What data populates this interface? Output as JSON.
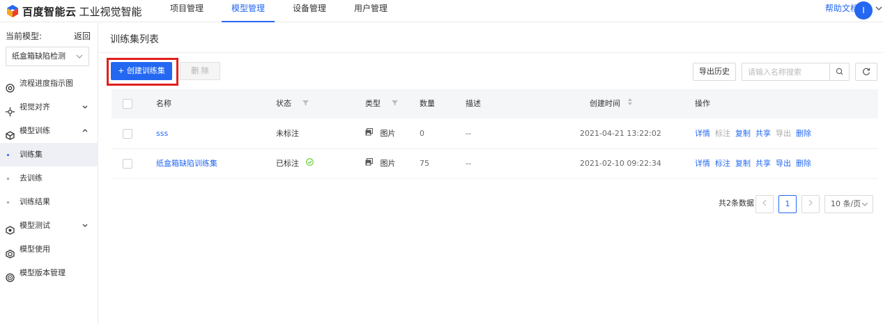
{
  "topbar": {
    "brand": "百度智能云",
    "product": "工业视觉智能",
    "nav": [
      {
        "label": "项目管理",
        "active": false
      },
      {
        "label": "模型管理",
        "active": true
      },
      {
        "label": "设备管理",
        "active": false
      },
      {
        "label": "用户管理",
        "active": false
      }
    ],
    "help": "帮助文档",
    "avatar": "I"
  },
  "sidebar": {
    "current_label": "当前模型:",
    "back": "返回",
    "model": "纸盒箱缺陷检测",
    "items": [
      {
        "label": "流程进度指示图",
        "icon": "flow-icon",
        "chevron": ""
      },
      {
        "label": "视觉对齐",
        "icon": "align-icon",
        "chevron": "down"
      },
      {
        "label": "模型训练",
        "icon": "cube-icon",
        "chevron": "up"
      },
      {
        "label": "训练集",
        "sub": true,
        "active": true
      },
      {
        "label": "去训练",
        "sub": true
      },
      {
        "label": "训练结果",
        "sub": true
      },
      {
        "label": "模型测试",
        "icon": "test-icon",
        "chevron": "down"
      },
      {
        "label": "模型使用",
        "icon": "use-icon",
        "chevron": ""
      },
      {
        "label": "模型版本管理",
        "icon": "version-icon",
        "chevron": ""
      }
    ]
  },
  "main": {
    "title": "训练集列表",
    "create_button": "+ 创建训练集",
    "delete_button": "删 除",
    "export_history": "导出历史",
    "search_placeholder": "请输入名称搜索",
    "columns": {
      "name": "名称",
      "status": "状态",
      "type": "类型",
      "count": "数量",
      "desc": "描述",
      "created": "创建时间",
      "ops": "操作"
    },
    "rows": [
      {
        "name": "sss",
        "status": "未标注",
        "status_done": false,
        "type": "图片",
        "count": "0",
        "desc": "--",
        "created": "2021-04-21 13:22:02"
      },
      {
        "name": "纸盒箱缺陷训练集",
        "status": "已标注",
        "status_done": true,
        "type": "图片",
        "count": "75",
        "desc": "--",
        "created": "2021-02-10 09:22:34"
      }
    ],
    "row_ops": [
      [
        {
          "label": "详情",
          "enabled": true
        },
        {
          "label": "标注",
          "enabled": false
        },
        {
          "label": "复制",
          "enabled": true
        },
        {
          "label": "共享",
          "enabled": true
        },
        {
          "label": "导出",
          "enabled": false
        },
        {
          "label": "删除",
          "enabled": true
        }
      ],
      [
        {
          "label": "详情",
          "enabled": true
        },
        {
          "label": "标注",
          "enabled": true
        },
        {
          "label": "复制",
          "enabled": true
        },
        {
          "label": "共享",
          "enabled": true
        },
        {
          "label": "导出",
          "enabled": true
        },
        {
          "label": "删除",
          "enabled": true
        }
      ]
    ]
  },
  "pagination": {
    "total": "共2条数据",
    "current_page": "1",
    "page_size": "10 条/页"
  },
  "colors": {
    "primary": "#2468f2",
    "highlight": "#e0201c",
    "success": "#52c41a"
  }
}
